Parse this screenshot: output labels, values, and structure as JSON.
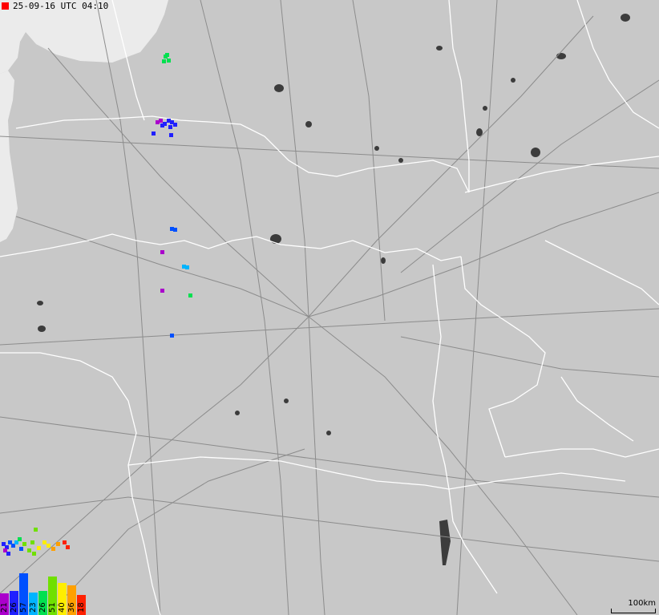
{
  "timestamp": "25-09-16 UTC 04:10",
  "scale_label": "100km",
  "colors": {
    "land": "#c8c8c8",
    "sea": "#ebebeb",
    "lake": "#3c3c3c",
    "roads": "#8c8c8c",
    "borders": "#ffffff",
    "timestamp_marker": "#ff0000"
  },
  "legend": [
    {
      "label": "21",
      "color": "#aa00cc",
      "count": 21
    },
    {
      "label": "26",
      "color": "#2020ff",
      "count": 26
    },
    {
      "label": "57",
      "color": "#0050ff",
      "count": 57
    },
    {
      "label": "23",
      "color": "#00b4ff",
      "count": 23
    },
    {
      "label": "26",
      "color": "#00e050",
      "count": 26
    },
    {
      "label": "51",
      "color": "#70e000",
      "count": 51
    },
    {
      "label": "40",
      "color": "#ffee00",
      "count": 40
    },
    {
      "label": "36",
      "color": "#ffa000",
      "count": 36
    },
    {
      "label": "18",
      "color": "#ff2000",
      "count": 18
    }
  ]
}
